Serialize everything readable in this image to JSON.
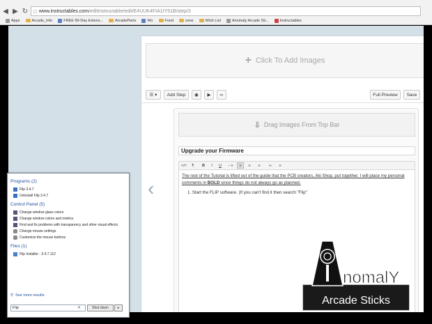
{
  "browser": {
    "url_host": "www.instructables.com",
    "url_path": "/editInstructable/edit/E4UUK4FIA1IY51B/step/3",
    "bookmarks": [
      {
        "label": "Apps",
        "icon": "apps-icon"
      },
      {
        "label": "Arcade_Info",
        "icon": "folder-icon"
      },
      {
        "label": "FREE 90-Day Extens...",
        "icon": "bookmark-icon"
      },
      {
        "label": "ArcadeParts",
        "icon": "folder-icon"
      },
      {
        "label": "Wo",
        "icon": "bookmark-icon"
      },
      {
        "label": "Food",
        "icon": "folder-icon"
      },
      {
        "label": "sons",
        "icon": "folder-icon"
      },
      {
        "label": "Wish List",
        "icon": "folder-icon"
      },
      {
        "label": "Anomaly Arcade Sti...",
        "icon": "bookmark-icon"
      },
      {
        "label": "Instructables",
        "icon": "bookmark-icon"
      }
    ]
  },
  "editor": {
    "add_images_label": "Click To Add Images",
    "add_step_label": "Add Step",
    "full_preview_label": "Full Preview",
    "save_label": "Save",
    "drag_images_label": "Drag Images From Top Bar",
    "step_title": "Upgrade your Firmware",
    "body_p1_a": "The rest of the Tutorial is lifted out of the guide that the PCB creators, Aki Shop, put together. I will place my personal comments in ",
    "body_p1_bold": "BOLD",
    "body_p1_b": " since things do not always go as planned.",
    "body_li1": "1.  Start the FLIP software. (If you can't find it then search \"Flip\""
  },
  "startmenu": {
    "programs_header": "Programs (2)",
    "programs": [
      "Flip 3.4.7",
      "Uninstall Flip 3.4.7"
    ],
    "control_panel_header": "Control Panel (5)",
    "control_panel": [
      "Change window glass colors",
      "Change window colors and metrics",
      "Find and fix problems with transparency and other visual effects",
      "Change mouse settings",
      "Customize the mouse buttons"
    ],
    "files_header": "Files (1)",
    "files": [
      "Flip Installer - 3.4.7.112"
    ],
    "see_more": "See more results",
    "search_value": "Flip",
    "shutdown_label": "Shut down"
  },
  "logo": {
    "text_top": "nomalY",
    "text_bottom": "Arcade Sticks"
  }
}
